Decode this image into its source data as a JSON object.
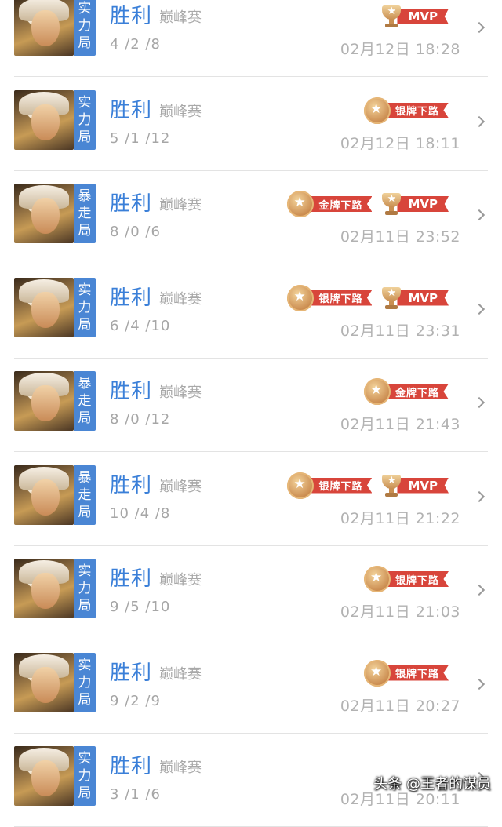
{
  "matches": [
    {
      "mode": [
        "实",
        "力",
        "局"
      ],
      "result": "胜利",
      "type": "巅峰赛",
      "kda": "4 /2 /8",
      "time": "02月12日 18:28",
      "badges": [
        {
          "kind": "mvp",
          "label": "MVP"
        }
      ]
    },
    {
      "mode": [
        "实",
        "力",
        "局"
      ],
      "result": "胜利",
      "type": "巅峰赛",
      "kda": "5 /1 /12",
      "time": "02月12日 18:11",
      "badges": [
        {
          "kind": "medal",
          "label": "银牌下路"
        }
      ]
    },
    {
      "mode": [
        "暴",
        "走",
        "局"
      ],
      "result": "胜利",
      "type": "巅峰赛",
      "kda": "8 /0 /6",
      "time": "02月11日 23:52",
      "badges": [
        {
          "kind": "medal",
          "label": "金牌下路"
        },
        {
          "kind": "mvp",
          "label": "MVP"
        }
      ]
    },
    {
      "mode": [
        "实",
        "力",
        "局"
      ],
      "result": "胜利",
      "type": "巅峰赛",
      "kda": "6 /4 /10",
      "time": "02月11日 23:31",
      "badges": [
        {
          "kind": "medal",
          "label": "银牌下路"
        },
        {
          "kind": "mvp",
          "label": "MVP"
        }
      ]
    },
    {
      "mode": [
        "暴",
        "走",
        "局"
      ],
      "result": "胜利",
      "type": "巅峰赛",
      "kda": "8 /0 /12",
      "time": "02月11日 21:43",
      "badges": [
        {
          "kind": "medal",
          "label": "金牌下路"
        }
      ]
    },
    {
      "mode": [
        "暴",
        "走",
        "局"
      ],
      "result": "胜利",
      "type": "巅峰赛",
      "kda": "10 /4 /8",
      "time": "02月11日 21:22",
      "badges": [
        {
          "kind": "medal",
          "label": "银牌下路"
        },
        {
          "kind": "mvp",
          "label": "MVP"
        }
      ]
    },
    {
      "mode": [
        "实",
        "力",
        "局"
      ],
      "result": "胜利",
      "type": "巅峰赛",
      "kda": "9 /5 /10",
      "time": "02月11日 21:03",
      "badges": [
        {
          "kind": "medal",
          "label": "银牌下路"
        }
      ]
    },
    {
      "mode": [
        "实",
        "力",
        "局"
      ],
      "result": "胜利",
      "type": "巅峰赛",
      "kda": "9 /2 /9",
      "time": "02月11日 20:27",
      "badges": [
        {
          "kind": "medal",
          "label": "银牌下路"
        }
      ]
    },
    {
      "mode": [
        "实",
        "力",
        "局"
      ],
      "result": "胜利",
      "type": "巅峰赛",
      "kda": "3 /1 /6",
      "time": "02月11日 20:11",
      "badges": []
    }
  ],
  "watermark": "头条 @王者的谋员",
  "colors": {
    "result": "#3a7fd8",
    "mode_badge": "#4a86d4",
    "ribbon": "#d8453b"
  }
}
